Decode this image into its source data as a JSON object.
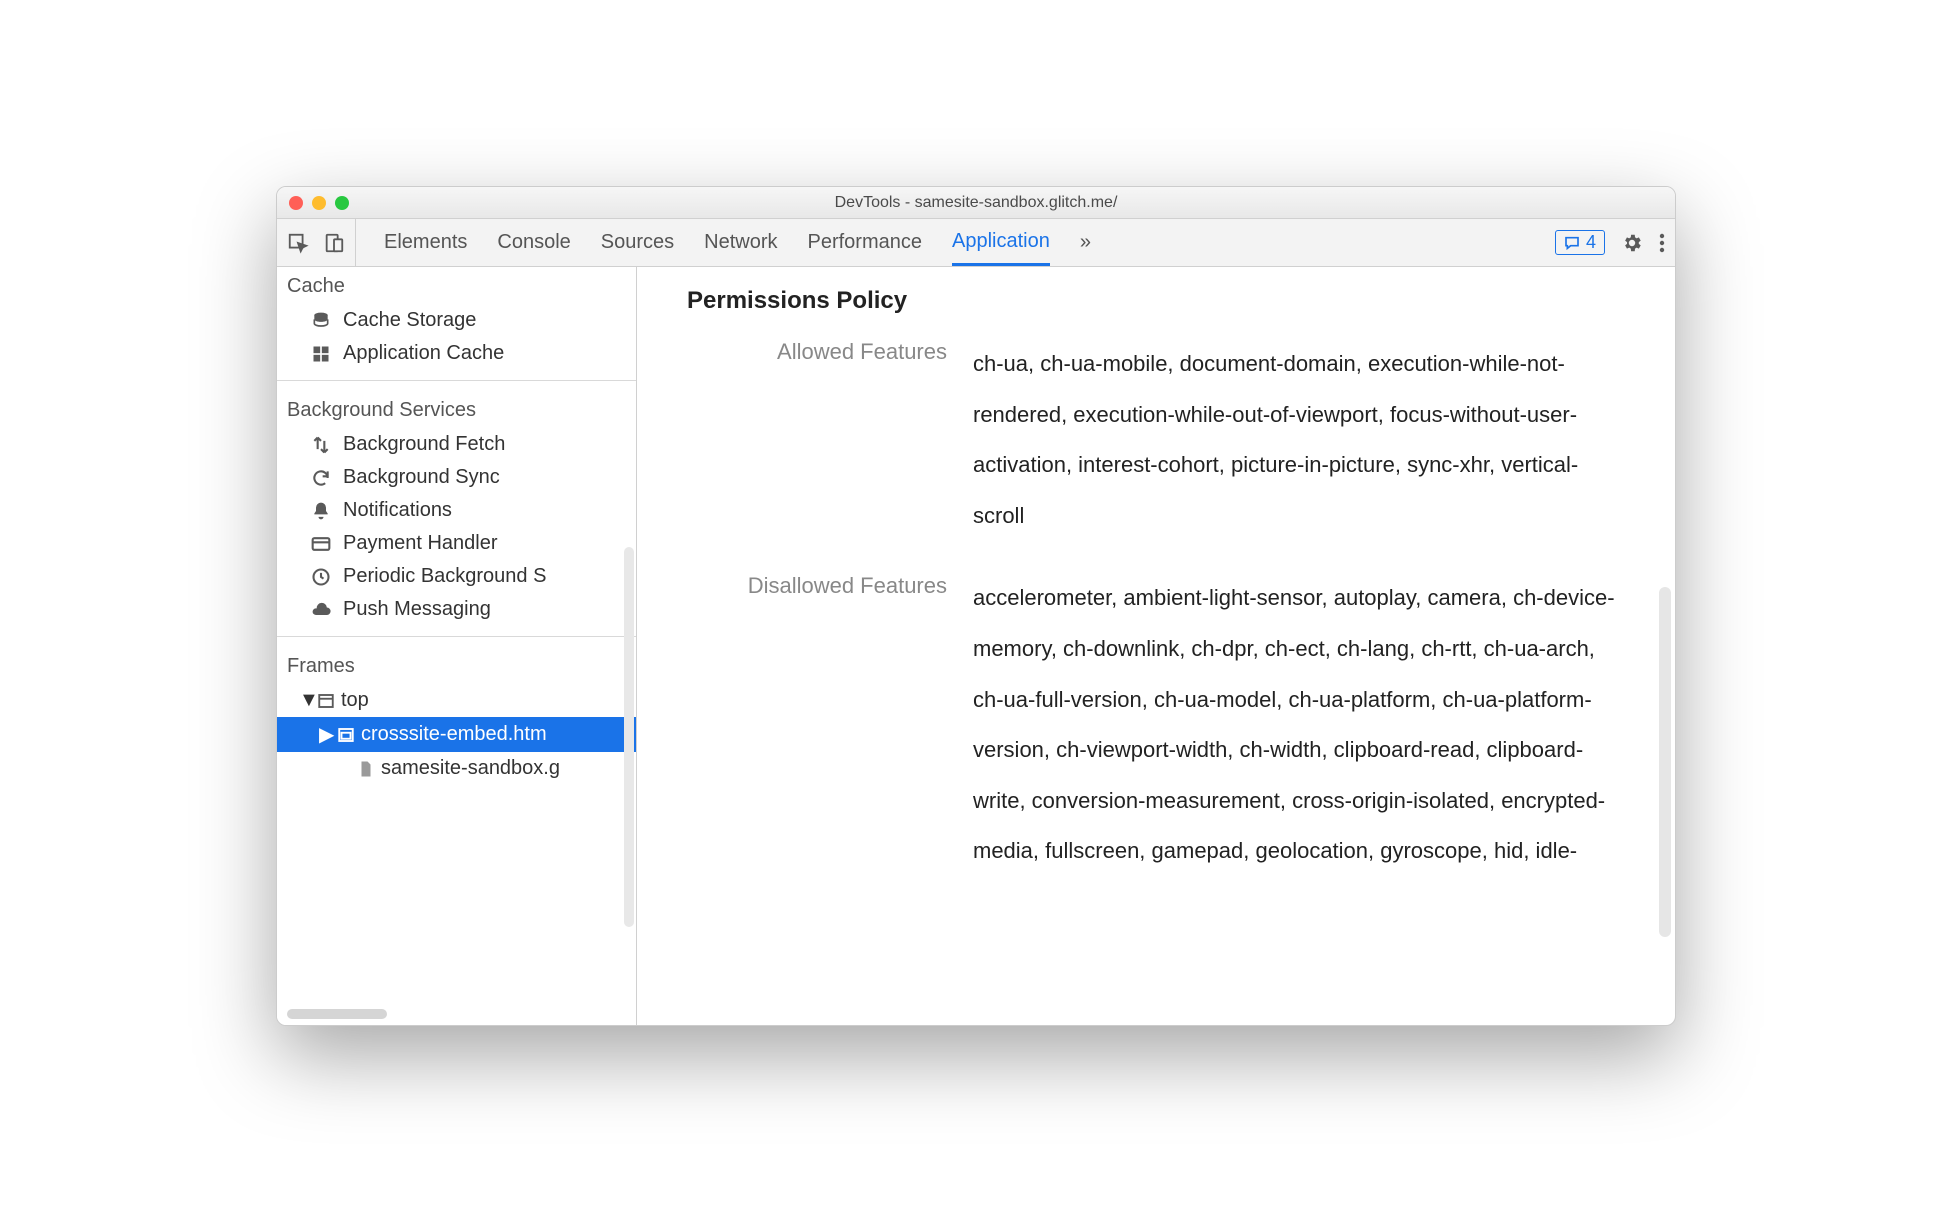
{
  "window": {
    "title": "DevTools - samesite-sandbox.glitch.me/"
  },
  "toolbar": {
    "tabs": [
      "Elements",
      "Console",
      "Sources",
      "Network",
      "Performance",
      "Application"
    ],
    "active_tab": "Application",
    "issues_count": "4"
  },
  "sidebar": {
    "sections": [
      {
        "title": "Cache",
        "items": [
          {
            "icon": "database-icon",
            "label": "Cache Storage"
          },
          {
            "icon": "grid-icon",
            "label": "Application Cache"
          }
        ]
      },
      {
        "title": "Background Services",
        "items": [
          {
            "icon": "swap-icon",
            "label": "Background Fetch"
          },
          {
            "icon": "sync-icon",
            "label": "Background Sync"
          },
          {
            "icon": "bell-icon",
            "label": "Notifications"
          },
          {
            "icon": "card-icon",
            "label": "Payment Handler"
          },
          {
            "icon": "clock-icon",
            "label": "Periodic Background S"
          },
          {
            "icon": "cloud-icon",
            "label": "Push Messaging"
          }
        ]
      },
      {
        "title": "Frames",
        "tree": true,
        "items": [
          {
            "icon": "window-icon",
            "label": "top",
            "expanded": true,
            "level": 1
          },
          {
            "icon": "frame-icon",
            "label": "crosssite-embed.htm",
            "expanded": false,
            "level": 2,
            "selected": true
          },
          {
            "icon": "file-icon",
            "label": "samesite-sandbox.g",
            "level": 3
          }
        ]
      }
    ]
  },
  "main": {
    "heading": "Permissions Policy",
    "rows": [
      {
        "label": "Allowed Features",
        "value": "ch-ua, ch-ua-mobile, document-domain, execution-while-not-rendered, execution-while-out-of-viewport, focus-without-user-activation, interest-cohort, picture-in-picture, sync-xhr, vertical-scroll"
      },
      {
        "label": "Disallowed Features",
        "value": "accelerometer, ambient-light-sensor, autoplay, camera, ch-device-memory, ch-downlink, ch-dpr, ch-ect, ch-lang, ch-rtt, ch-ua-arch, ch-ua-full-version, ch-ua-model, ch-ua-platform, ch-ua-platform-version, ch-viewport-width, ch-width, clipboard-read, clipboard-write, conversion-measurement, cross-origin-isolated, encrypted-media, fullscreen, gamepad, geolocation, gyroscope, hid, idle-"
      }
    ]
  }
}
